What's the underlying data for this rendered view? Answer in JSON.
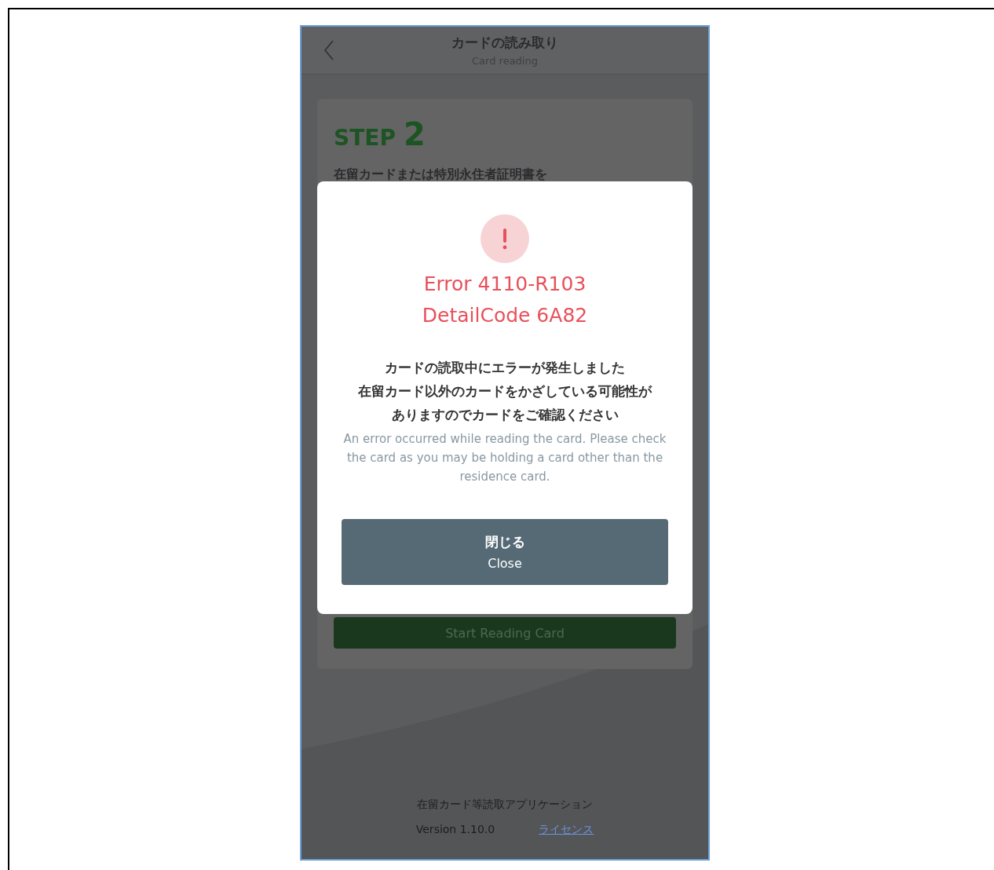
{
  "header": {
    "title": "カードの読み取り",
    "subtitle": "Card reading"
  },
  "step": {
    "label": "STEP",
    "number": "2",
    "instruction": "在留カードまたは特別永住者証明書を"
  },
  "start_button": {
    "label": "Start Reading Card"
  },
  "dialog": {
    "error_code": "Error 4110-R103",
    "detail_code": "DetailCode 6A82",
    "message_ja": [
      "カードの読取中にエラーが発生しました",
      "在留カード以外のカードをかざしている可能性が",
      "ありますのでカードをご確認ください"
    ],
    "message_en": "An error occurred while reading the card. Please check the card as you may be holding a card other than the residence card.",
    "button": {
      "label_ja": "閉じる",
      "label_en": "Close"
    }
  },
  "footer": {
    "app_name": "在留カード等読取アプリケーション",
    "version": "Version 1.10.0",
    "license_link": "ライセンス"
  }
}
